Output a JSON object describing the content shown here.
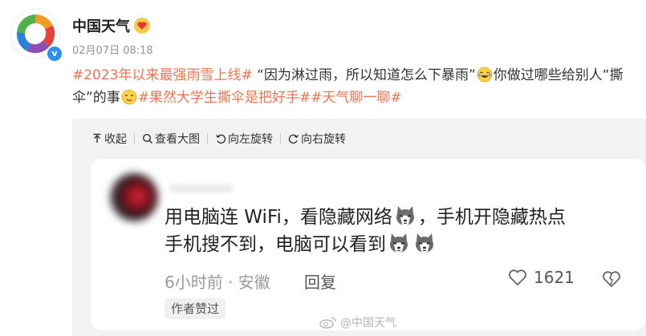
{
  "post": {
    "author": "中国天气",
    "time": "02月07日 08:18",
    "verified_mark": "v",
    "segments": [
      {
        "text": "#2023年以来最强雨雪上线#",
        "kind": "tag"
      },
      {
        "text": " “因为淋过雨，所以知道怎么下暴雨”",
        "kind": "text"
      },
      {
        "emoji": "laugh-cry"
      },
      {
        "text": "你做过哪些给别人“撕伞”的事",
        "kind": "text"
      },
      {
        "emoji": "cheeky"
      },
      {
        "text": "#果然大学生撕伞是把好手##天气聊一聊#",
        "kind": "tag"
      }
    ]
  },
  "toolbar": {
    "collapse": "收起",
    "view_large": "查看大图",
    "rotate_left": "向左旋转",
    "rotate_right": "向右旋转"
  },
  "comment": {
    "line1_a": "用电脑连 WiFi，看隐藏网络",
    "line1_b": "，手机开隐藏热点",
    "line2": "手机搜不到，电脑可以看到",
    "meta": "6小时前 · 安徽",
    "reply": "回复",
    "likes": "1621",
    "author_liked": "作者赞过"
  },
  "watermark": {
    "text": "@中国天气"
  },
  "colors": {
    "tag": "#eb7350",
    "verified": "#2b8ff0",
    "toolbar_bg": "#f2f2f2"
  },
  "icons": {
    "collapse": "up-arrow-icon",
    "view_large": "magnifier-icon",
    "rotate_left": "rotate-left-icon",
    "rotate_right": "rotate-right-icon",
    "like": "heart-icon",
    "dislike": "broken-heart-icon",
    "weibo": "weibo-logo-icon"
  }
}
